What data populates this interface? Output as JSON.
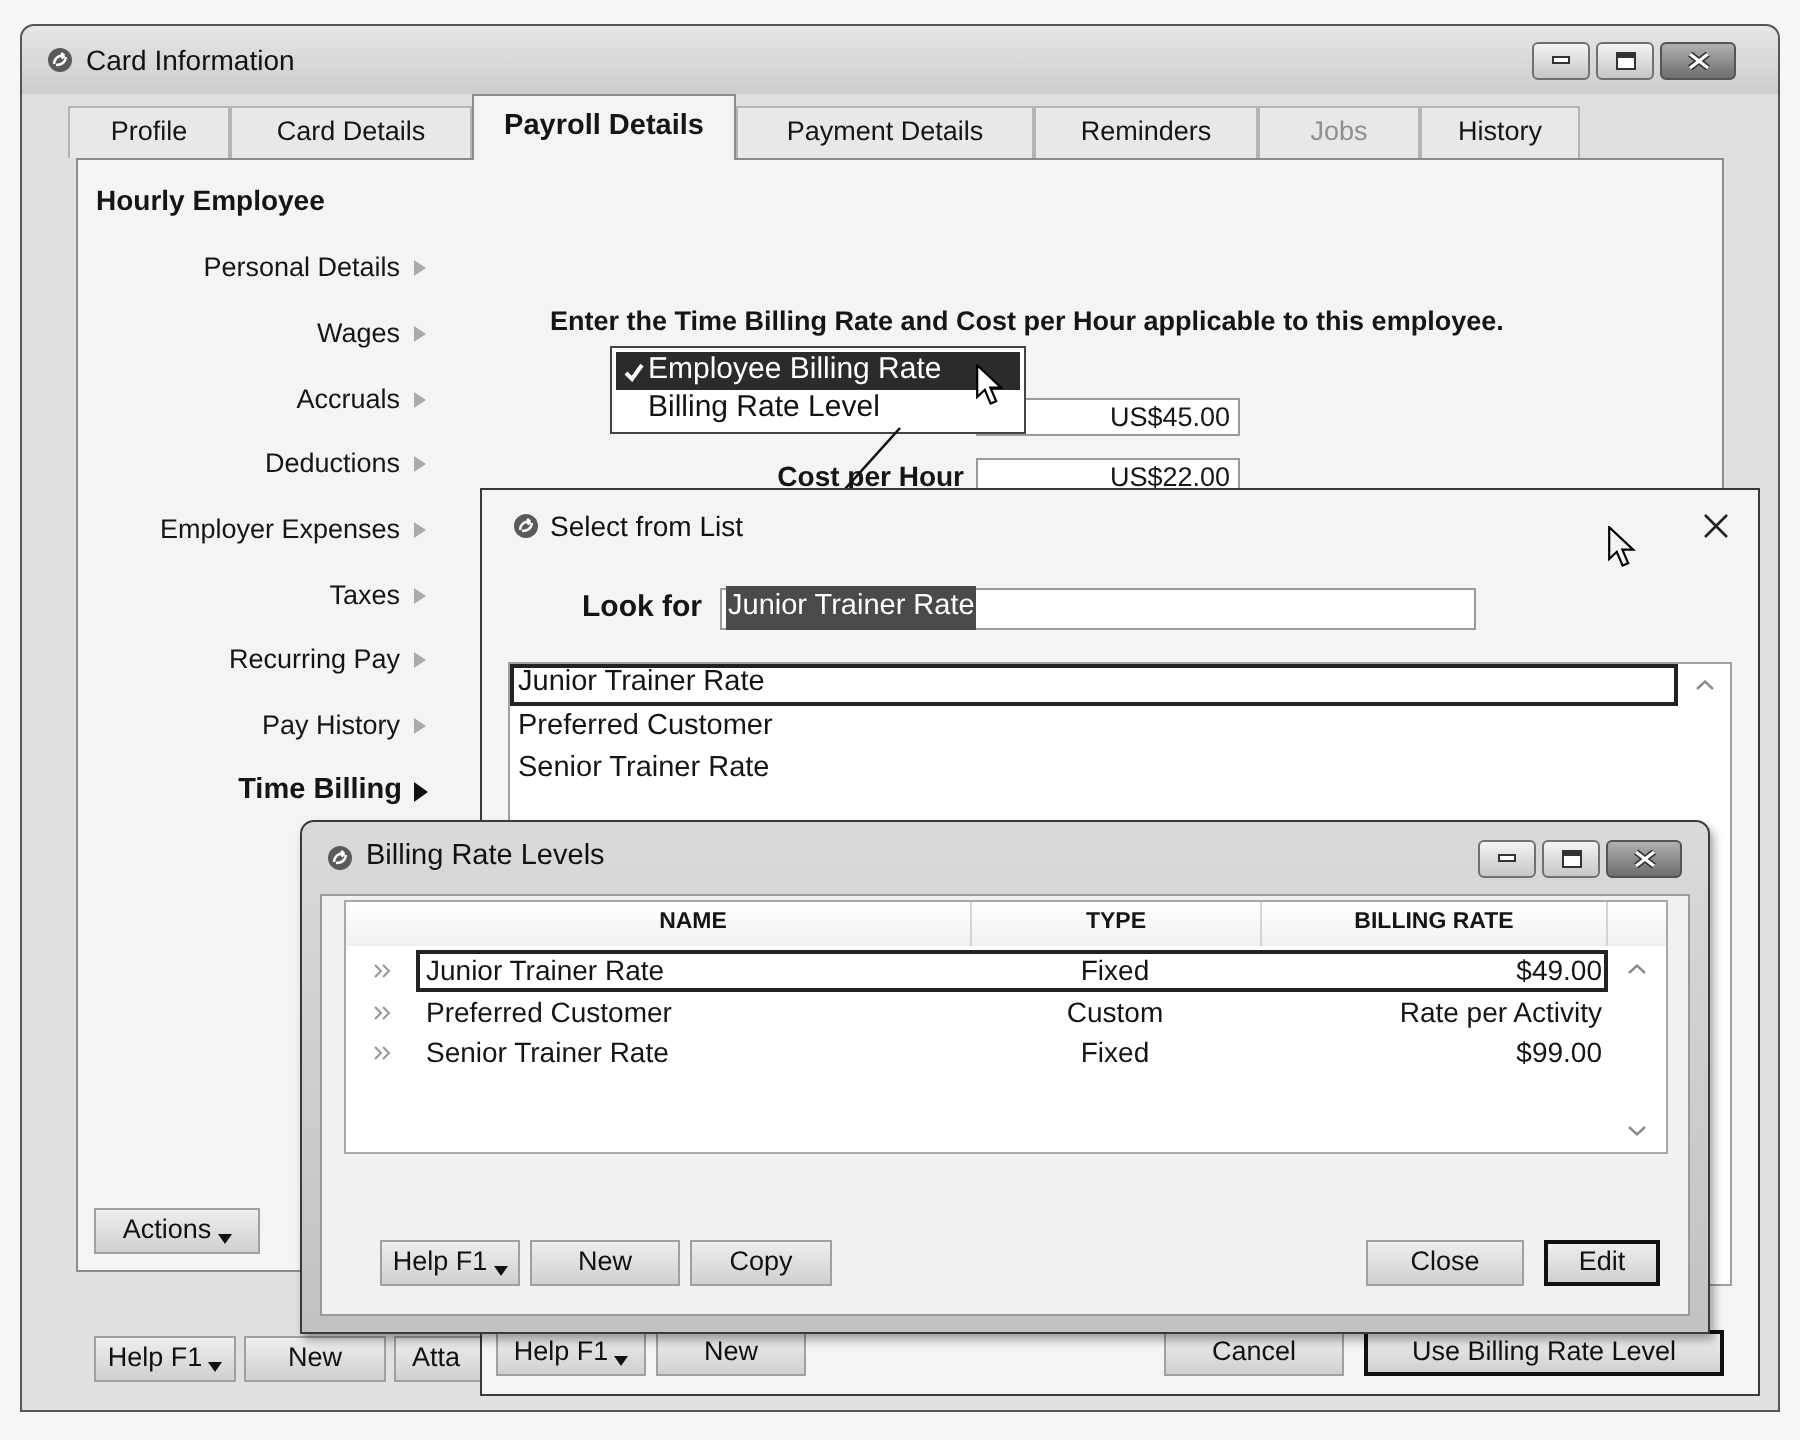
{
  "window": {
    "title": "Card Information"
  },
  "tabs": [
    {
      "label": "Profile",
      "selected": false,
      "disabled": false
    },
    {
      "label": "Card Details",
      "selected": false,
      "disabled": false
    },
    {
      "label": "Payroll Details",
      "selected": true,
      "disabled": false
    },
    {
      "label": "Payment Details",
      "selected": false,
      "disabled": false
    },
    {
      "label": "Reminders",
      "selected": false,
      "disabled": false
    },
    {
      "label": "Jobs",
      "selected": false,
      "disabled": true
    },
    {
      "label": "History",
      "selected": false,
      "disabled": false
    }
  ],
  "employee_type": "Hourly Employee",
  "sections": [
    {
      "label": "Personal Details",
      "selected": false
    },
    {
      "label": "Wages",
      "selected": false
    },
    {
      "label": "Accruals",
      "selected": false
    },
    {
      "label": "Deductions",
      "selected": false
    },
    {
      "label": "Employer Expenses",
      "selected": false
    },
    {
      "label": "Taxes",
      "selected": false
    },
    {
      "label": "Recurring Pay",
      "selected": false
    },
    {
      "label": "Pay History",
      "selected": false
    },
    {
      "label": "Time Billing",
      "selected": true
    }
  ],
  "time_billing": {
    "instruction": "Enter the Time Billing Rate and Cost per Hour applicable to this employee.",
    "rate_menu": [
      {
        "label": "Employee Billing Rate",
        "checked": true,
        "selected": true
      },
      {
        "label": "Billing Rate Level",
        "checked": false,
        "selected": false
      }
    ],
    "billing_rate": "US$45.00",
    "cost_per_hour": {
      "label": "Cost per Hour",
      "value": "US$22.00"
    }
  },
  "actions_button": {
    "label": "Actions",
    "kind": "menu"
  },
  "footer_buttons": [
    {
      "label": "Help F1",
      "kind": "menu"
    },
    {
      "label": "New",
      "kind": "plain"
    },
    {
      "label": "Atta",
      "kind": "plain"
    }
  ],
  "select_dialog": {
    "title": "Select from List",
    "look_for": {
      "label": "Look for",
      "value": "Junior Trainer Rate",
      "value_selected": true
    },
    "items": [
      {
        "label": "Junior Trainer Rate",
        "selected": true
      },
      {
        "label": "Preferred Customer",
        "selected": false
      },
      {
        "label": "Senior Trainer Rate",
        "selected": false
      }
    ],
    "left_buttons": [
      {
        "label": "Help F1",
        "kind": "menu",
        "default": false
      },
      {
        "label": "New",
        "kind": "plain",
        "default": false
      }
    ],
    "right_buttons": [
      {
        "label": "Cancel",
        "default": false
      },
      {
        "label": "Use Billing Rate Level",
        "default": true
      }
    ]
  },
  "levels_window": {
    "title": "Billing Rate Levels",
    "columns": [
      "NAME",
      "TYPE",
      "BILLING RATE"
    ],
    "rows": [
      {
        "name": "Junior Trainer Rate",
        "type": "Fixed",
        "billing_rate": "$49.00",
        "selected": true
      },
      {
        "name": "Preferred Customer",
        "type": "Custom",
        "billing_rate": "Rate per Activity",
        "selected": false
      },
      {
        "name": "Senior Trainer Rate",
        "type": "Fixed",
        "billing_rate": "$99.00",
        "selected": false
      }
    ],
    "left_buttons": [
      {
        "label": "Help F1",
        "kind": "menu",
        "default": false
      },
      {
        "label": "New",
        "kind": "plain",
        "default": false
      },
      {
        "label": "Copy",
        "kind": "plain",
        "default": false
      }
    ],
    "right_buttons": [
      {
        "label": "Close",
        "default": false
      },
      {
        "label": "Edit",
        "default": true
      }
    ]
  }
}
